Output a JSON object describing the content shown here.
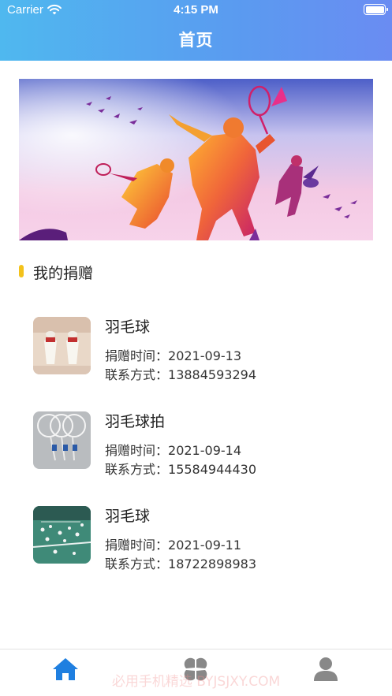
{
  "status_bar": {
    "carrier": "Carrier",
    "time": "4:15 PM",
    "battery_level": 1.0
  },
  "header": {
    "title": "首页"
  },
  "banner": {
    "image": "badminton-silhouettes-banner"
  },
  "section": {
    "title": "我的捐赠"
  },
  "donations": [
    {
      "name": "羽毛球",
      "time_label": "捐赠时间：",
      "time": "2021-09-13",
      "contact_label": "联系方式：",
      "contact": "13884593294",
      "thumbnail": "shuttlecocks-photo"
    },
    {
      "name": "羽毛球拍",
      "time_label": "捐赠时间：",
      "time": "2021-09-14",
      "contact_label": "联系方式：",
      "contact": "15584944430",
      "thumbnail": "rackets-photo"
    },
    {
      "name": "羽毛球",
      "time_label": "捐赠时间：",
      "time": "2021-09-11",
      "contact_label": "联系方式：",
      "contact": "18722898983",
      "thumbnail": "shuttlecock-court-photo"
    }
  ],
  "tabbar": {
    "active_color": "#1f7fe0",
    "inactive_color": "#888888",
    "tabs": [
      {
        "icon": "home-icon",
        "active": true
      },
      {
        "icon": "grid-icon",
        "active": false
      },
      {
        "icon": "person-icon",
        "active": false
      }
    ],
    "watermark": "必用手机精选 BYJSJXY.COM"
  },
  "colors": {
    "header_start": "#4fb8ef",
    "header_end": "#6a8cf2",
    "section_accent": "#f3c21b"
  }
}
